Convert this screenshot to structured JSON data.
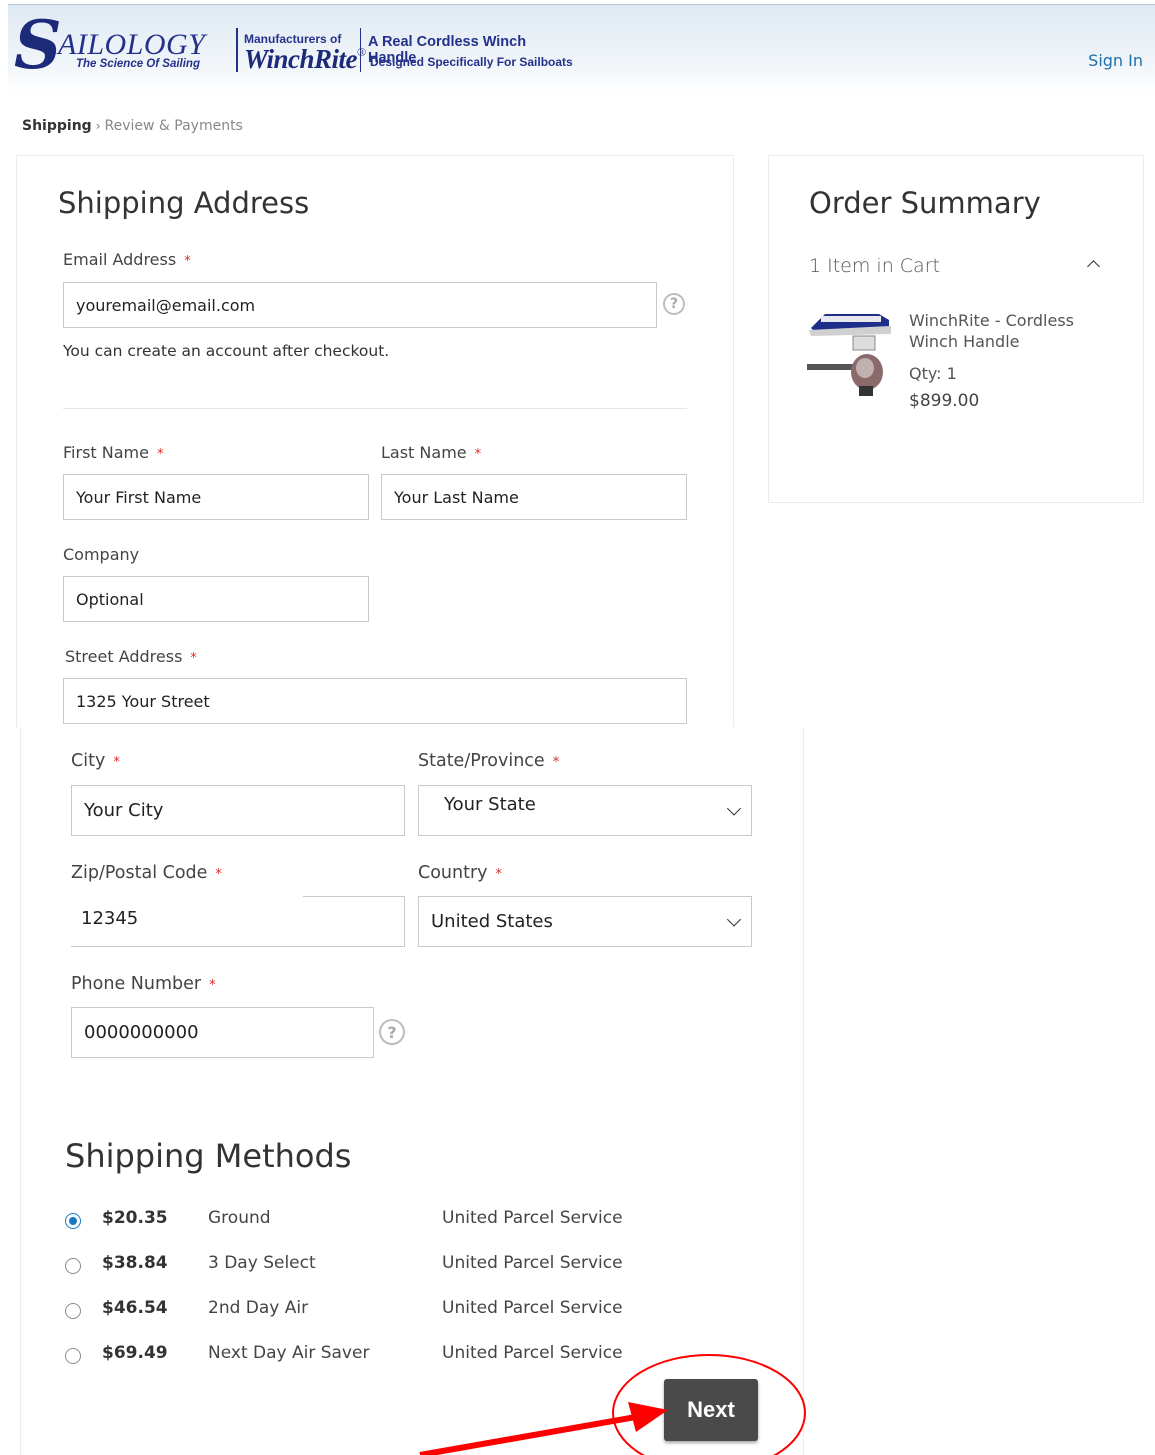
{
  "header": {
    "logo_s": "S",
    "logo_name": "AILOLOGY",
    "logo_tagline": "The Science Of Sailing",
    "mfr_label": "Manufacturers of",
    "brand": "WinchRite",
    "reg_mark": "®",
    "headline": "A Real Cordless Winch Handle",
    "subheadline": "Designed Specifically For Sailboats",
    "sign_in": "Sign In"
  },
  "breadcrumb": {
    "current": "Shipping",
    "separator": "›",
    "next": "Review & Payments"
  },
  "shipping_address": {
    "title": "Shipping Address",
    "email_label": "Email Address",
    "email_value": "youremail@email.com",
    "email_note": "You can create an account after checkout.",
    "first_label": "First Name",
    "first_value": "Your First Name",
    "last_label": "Last Name",
    "last_value": "Your Last Name",
    "company_label": "Company",
    "company_value": "Optional",
    "street_label": "Street Address",
    "street_value": "1325 Your Street",
    "city_label": "City",
    "city_value": "Your City",
    "state_label": "State/Province",
    "state_value": "Your State",
    "zip_label": "Zip/Postal Code",
    "zip_value": "12345",
    "country_label": "Country",
    "country_value": "United States",
    "phone_label": "Phone Number",
    "phone_value": "0000000000",
    "required_mark": "*",
    "help_mark": "?"
  },
  "order_summary": {
    "title": "Order Summary",
    "items_in_cart": "1 Item in Cart",
    "item_name": "WinchRite - Cordless Winch Handle",
    "item_qty": "Qty: 1",
    "item_price": "$899.00"
  },
  "shipping_methods": {
    "title": "Shipping Methods",
    "methods": [
      {
        "price": "$20.35",
        "name": "Ground",
        "carrier": "United Parcel Service",
        "selected": true
      },
      {
        "price": "$38.84",
        "name": "3 Day Select",
        "carrier": "United Parcel Service",
        "selected": false
      },
      {
        "price": "$46.54",
        "name": "2nd Day Air",
        "carrier": "United Parcel Service",
        "selected": false
      },
      {
        "price": "$69.49",
        "name": "Next Day Air Saver",
        "carrier": "United Parcel Service",
        "selected": false
      }
    ]
  },
  "next_button": "Next",
  "colors": {
    "accent": "#1979c3",
    "required": "#e02b27",
    "annotation": "#ff0000",
    "button": "#4a4a4a"
  }
}
